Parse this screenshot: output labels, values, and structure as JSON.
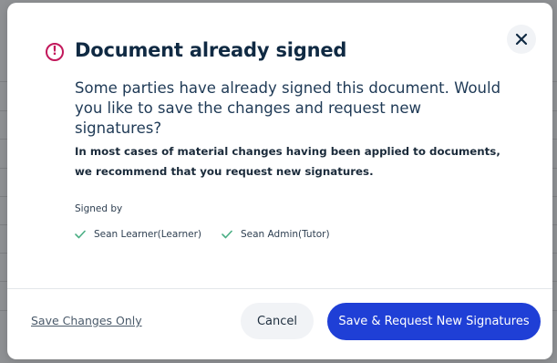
{
  "dialog": {
    "title": "Document already signed",
    "message": "Some parties have already signed this document. Would you like to save the changes and request new signatures?",
    "note": "In most cases of material changes having been applied to documents, we recommend that you request new signatures.",
    "signed_by_label": "Signed by",
    "signers": [
      {
        "name": "Sean Learner(Learner)"
      },
      {
        "name": "Sean Admin(Tutor)"
      }
    ]
  },
  "footer": {
    "save_only_label": "Save Changes Only",
    "cancel_label": "Cancel",
    "primary_label": "Save & Request New Signatures"
  },
  "colors": {
    "accent": "#1f3fd6",
    "alert": "#c2185b",
    "check": "#4caf85"
  },
  "icons": {
    "alert": "exclamation-circle-icon",
    "close": "close-icon",
    "check": "checkmark-icon"
  }
}
